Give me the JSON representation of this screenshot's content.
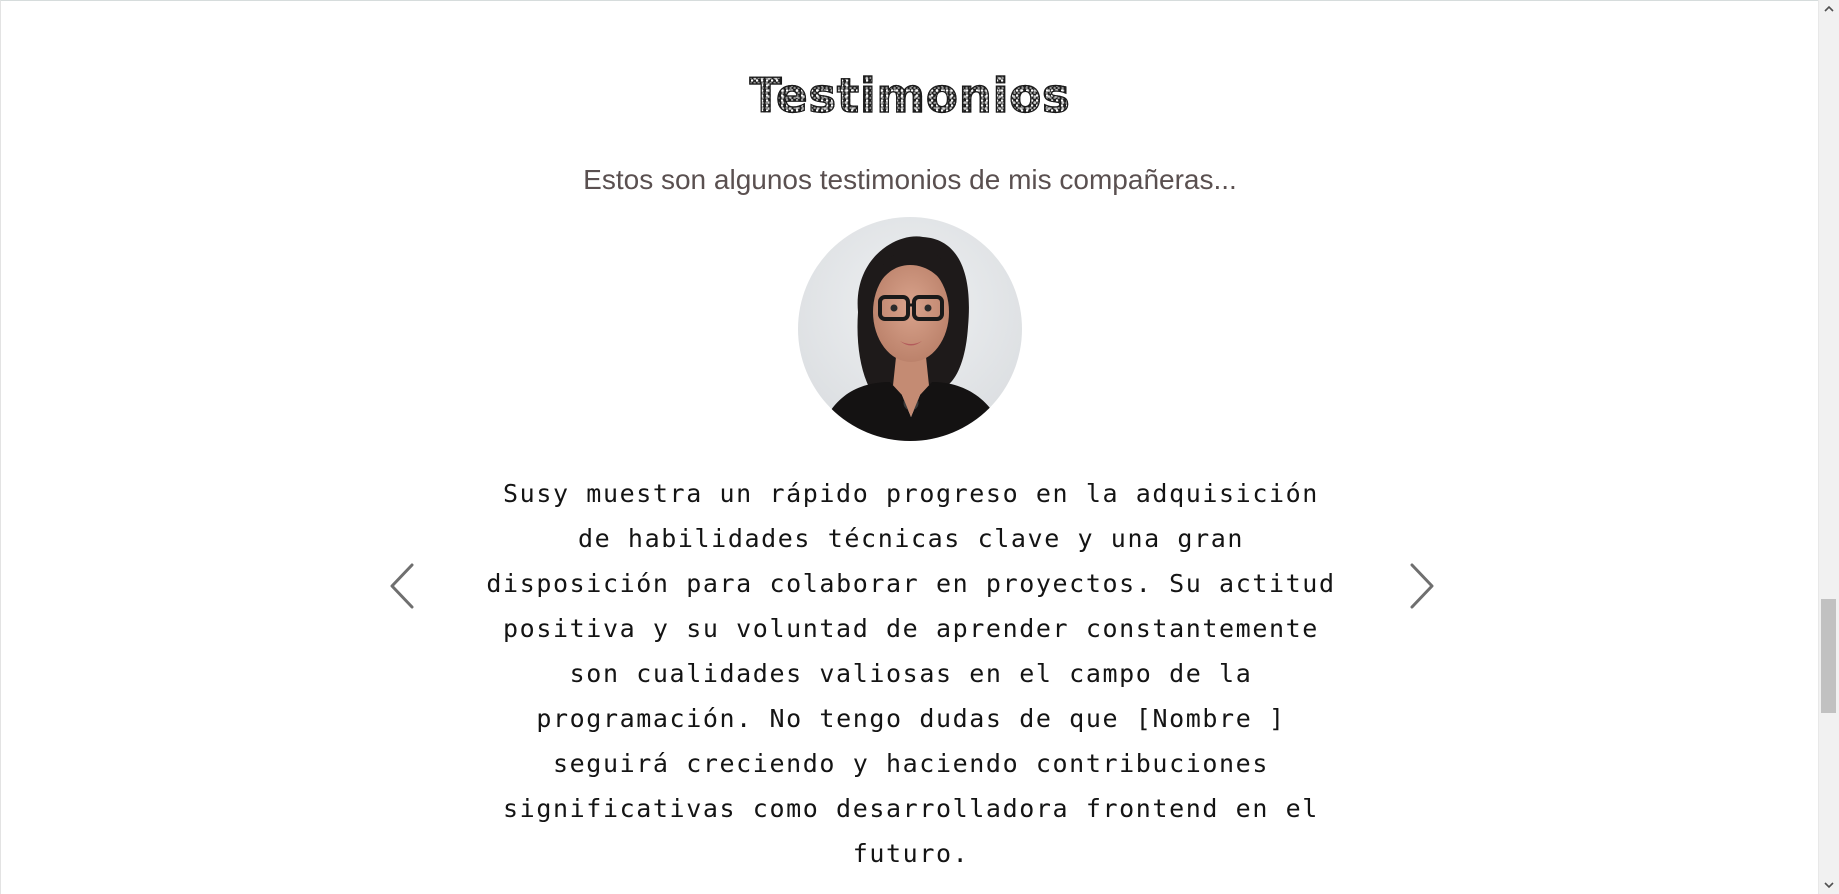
{
  "section": {
    "title": "Testimonios",
    "subtitle": "Estos son algunos testimonios de mis compañeras..."
  },
  "testimonial": {
    "avatar_icon": "person-avatar-photo",
    "quote": "Susy muestra un rápido progreso en la adquisición de habilidades técnicas clave y una gran disposición para colaborar en proyectos. Su actitud positiva y su voluntad de aprender constantemente son cualidades valiosas en el campo de la programación. No tengo dudas de que [Nombre ] seguirá creciendo y haciendo contribuciones significativas como desarrolladora frontend en el futuro."
  },
  "carousel": {
    "prev_icon": "chevron-left-icon",
    "next_icon": "chevron-right-icon"
  },
  "scrollbar": {
    "up_icon": "scroll-up-arrow-icon",
    "down_icon": "scroll-down-arrow-icon",
    "position_fraction": 0.72
  },
  "colors": {
    "background": "#ffffff",
    "subtitle": "#5a5050",
    "text": "#141414",
    "arrow": "#6f6f6f"
  }
}
